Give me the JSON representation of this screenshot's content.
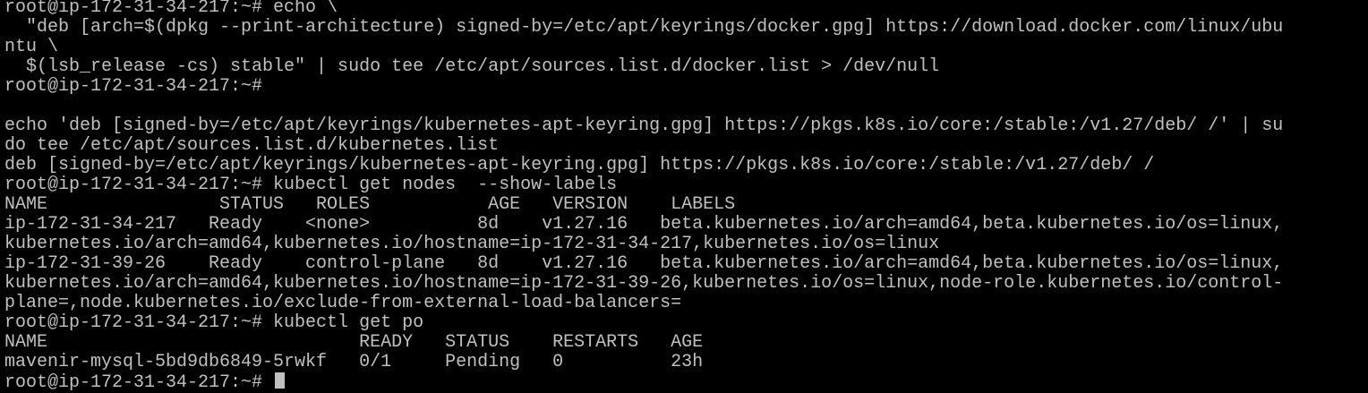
{
  "terminal": {
    "lines": [
      "root@ip-172-31-34-217:~# echo \\",
      "  \"deb [arch=$(dpkg --print-architecture) signed-by=/etc/apt/keyrings/docker.gpg] https://download.docker.com/linux/ubu",
      "ntu \\",
      "  $(lsb_release -cs) stable\" | sudo tee /etc/apt/sources.list.d/docker.list > /dev/null",
      "root@ip-172-31-34-217:~#",
      "",
      "echo 'deb [signed-by=/etc/apt/keyrings/kubernetes-apt-keyring.gpg] https://pkgs.k8s.io/core:/stable:/v1.27/deb/ /' | su",
      "do tee /etc/apt/sources.list.d/kubernetes.list",
      "deb [signed-by=/etc/apt/keyrings/kubernetes-apt-keyring.gpg] https://pkgs.k8s.io/core:/stable:/v1.27/deb/ /",
      "root@ip-172-31-34-217:~# kubectl get nodes  --show-labels",
      "NAME                STATUS   ROLES           AGE   VERSION    LABELS",
      "ip-172-31-34-217   Ready    <none>          8d    v1.27.16   beta.kubernetes.io/arch=amd64,beta.kubernetes.io/os=linux,",
      "kubernetes.io/arch=amd64,kubernetes.io/hostname=ip-172-31-34-217,kubernetes.io/os=linux",
      "ip-172-31-39-26    Ready    control-plane   8d    v1.27.16   beta.kubernetes.io/arch=amd64,beta.kubernetes.io/os=linux,",
      "kubernetes.io/arch=amd64,kubernetes.io/hostname=ip-172-31-39-26,kubernetes.io/os=linux,node-role.kubernetes.io/control-",
      "plane=,node.kubernetes.io/exclude-from-external-load-balancers=",
      "root@ip-172-31-34-217:~# kubectl get po",
      "NAME                             READY   STATUS    RESTARTS   AGE",
      "mavenir-mysql-5bd9db6849-5rwkf   0/1     Pending   0          23h",
      "root@ip-172-31-34-217:~# "
    ]
  },
  "colors": {
    "background": "#000000",
    "foreground": "#c0c0c0"
  }
}
